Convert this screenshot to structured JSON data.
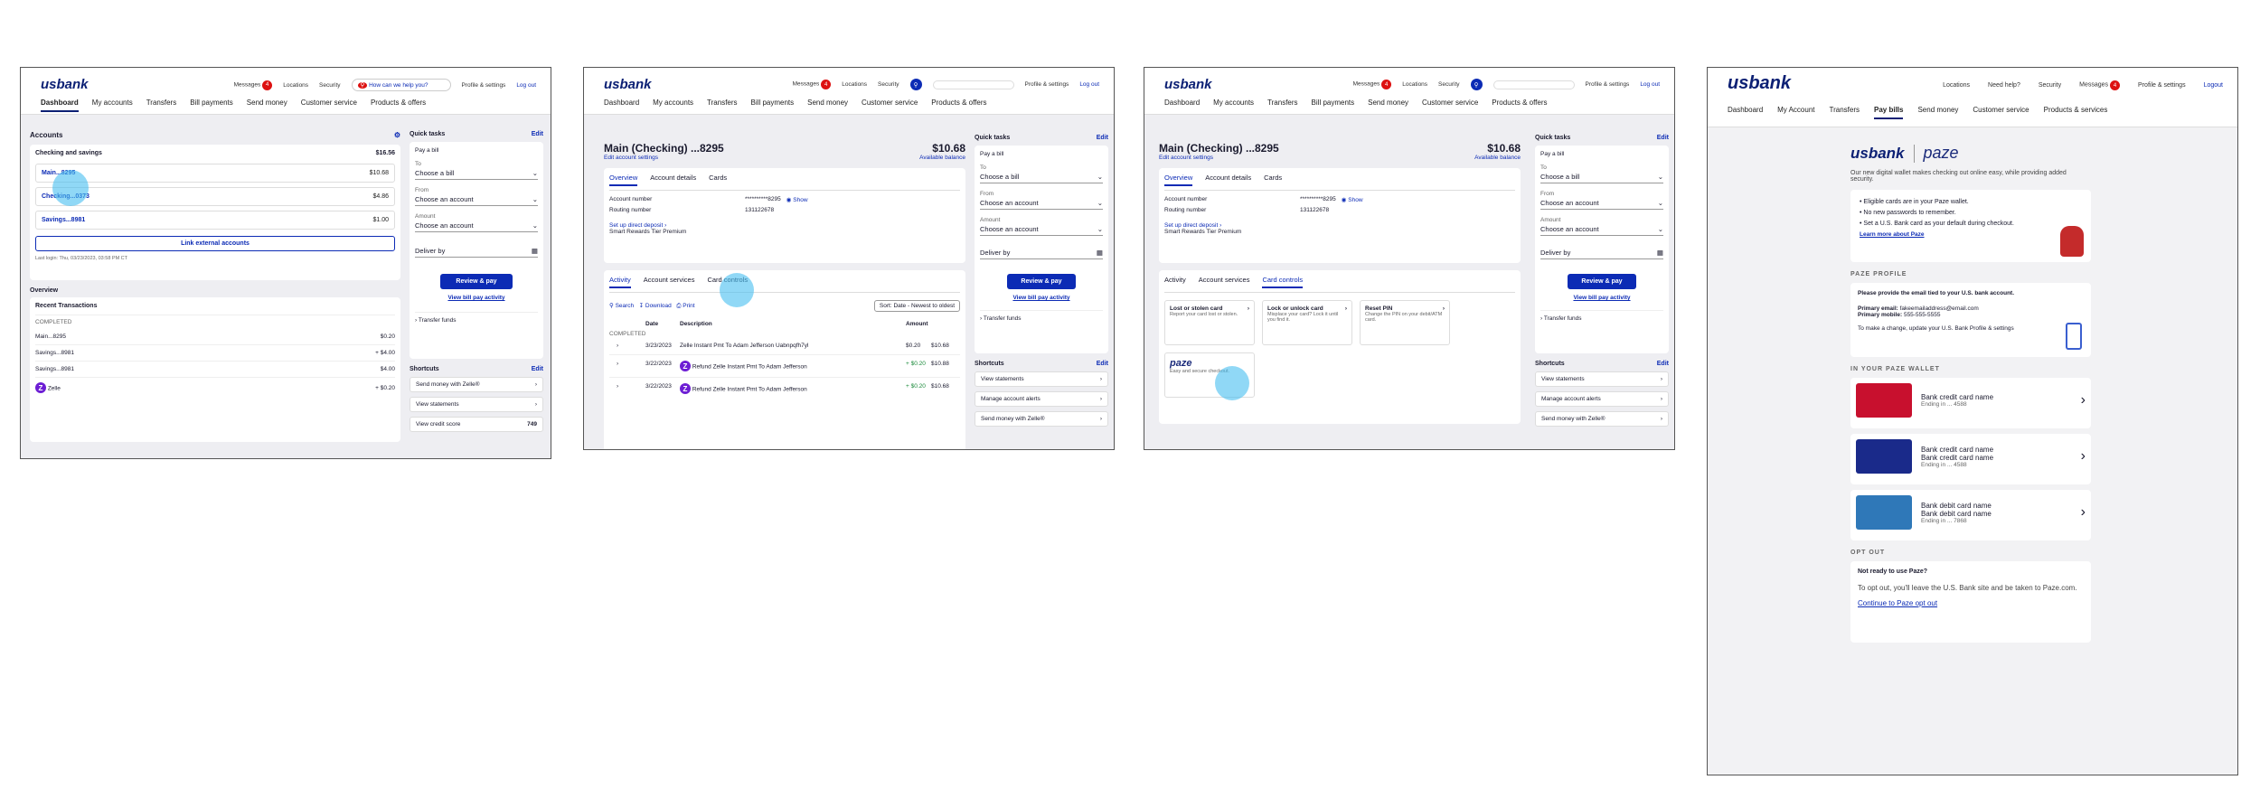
{
  "brand": {
    "logo": "usbank",
    "paze": "paze"
  },
  "header": {
    "messages": "Messages",
    "msg_count": "4",
    "locations": "Locations",
    "security": "Security",
    "help": "How can we help you?",
    "profile": "Profile & settings",
    "logout": "Log out"
  },
  "nav": [
    "Dashboard",
    "My accounts",
    "Transfers",
    "Bill payments",
    "Send money",
    "Customer service",
    "Products & offers"
  ],
  "s1": {
    "accounts": "Accounts",
    "cs": "Checking and savings",
    "cs_amt": "$16.56",
    "acc": [
      {
        "name": "Main...8295",
        "amt": "$10.68"
      },
      {
        "name": "Checking...0373",
        "amt": "$4.86"
      },
      {
        "name": "Savings...8981",
        "amt": "$1.00"
      }
    ],
    "link_ext": "Link external accounts",
    "last_login": "Last login: Thu, 03/23/2023, 03:58 PM CT",
    "overview": "Overview",
    "recent": "Recent Transactions",
    "completed": "COMPLETED",
    "tx": [
      {
        "n": "Main...8295",
        "a": "$0.20",
        "d": "3/23/2023"
      },
      {
        "n": "Savings...8981",
        "a": "+ $4.00",
        "d": "3/23/2023"
      },
      {
        "n": "Savings...8981",
        "a": "$4.00",
        "d": "3/20/2023"
      },
      {
        "n": "Zelle",
        "a": "+ $0.20",
        "d": "3/23/2023"
      }
    ]
  },
  "qt": {
    "title": "Quick tasks",
    "edit": "Edit",
    "pay": "Pay a bill",
    "to": "To",
    "choose_bill": "Choose a bill",
    "from": "From",
    "choose_acc": "Choose an account",
    "amount": "Amount",
    "deliver": "Deliver by",
    "review": "Review & pay",
    "view_bill": "View bill pay activity",
    "transfer": "Transfer funds",
    "shortcuts": "Shortcuts",
    "sc1": [
      "Send money with Zelle®",
      "View statements",
      "View credit score"
    ],
    "score": "749",
    "sc2": [
      "View statements",
      "Manage account alerts",
      "Send money with Zelle®"
    ]
  },
  "s2": {
    "title": "Main (Checking) ...8295",
    "edit_name": "Edit account settings",
    "bal": "$10.68",
    "avail": "Available balance",
    "tabs": [
      "Overview",
      "Account details",
      "Cards"
    ],
    "acct_no": "Account number",
    "acct_val": "**********8295",
    "show": "Show",
    "routing": "Routing number",
    "routing_val": "131122678",
    "direct": "Set up direct deposit",
    "tier": "Smart Rewards Tier Premium",
    "tabs2": [
      "Activity",
      "Account services",
      "Card controls"
    ],
    "search": "Search",
    "download": "Download",
    "print": "Print",
    "sort": "Sort: Date - Newest to oldest",
    "cols": [
      "Date",
      "Description",
      "Amount"
    ],
    "completed": "COMPLETED",
    "tx": [
      {
        "d": "3/23/2023",
        "desc": "Zelle Instant Pmt To Adam Jefferson Uabnpqfh7yl",
        "a": "$0.20",
        "b": "$10.68"
      },
      {
        "d": "3/22/2023",
        "desc": "Refund Zelle Instant Pmt To Adam Jefferson",
        "a": "+ $0.20",
        "b": "$10.88"
      },
      {
        "d": "3/22/2023",
        "desc": "Refund Zelle Instant Pmt To Adam Jefferson",
        "a": "+ $0.20",
        "b": "$10.68"
      }
    ]
  },
  "s3": {
    "cards": [
      {
        "t": "Lost or stolen card",
        "d": "Report your card lost or stolen."
      },
      {
        "t": "Lock or unlock card",
        "d": "Misplace your card? Lock it until you find it."
      },
      {
        "t": "Reset PIN",
        "d": "Change the PIN on your debit/ATM card."
      }
    ],
    "paze_desc": "Easy and secure checkout."
  },
  "s4": {
    "nav": [
      "Dashboard",
      "My Account",
      "Transfers",
      "Pay bills",
      "Send money",
      "Customer service",
      "Products & services"
    ],
    "util": [
      "Locations",
      "Need help?",
      "Security",
      "Messages",
      "Profile & settings",
      "Logout"
    ],
    "intro": "Our new digital wallet makes checking out online easy, while providing added security.",
    "bullets": [
      "Eligible cards are in your Paze wallet.",
      "No new passwords to remember.",
      "Set a U.S. Bank card as your default during checkout."
    ],
    "learn": "Learn more about Paze",
    "profile_h": "PAZE PROFILE",
    "profile_q": "Please provide the email tied to your U.S. bank account.",
    "email_l": "Primary email:",
    "email_v": "fakeemailaddress@email.com",
    "mobile_l": "Primary mobile:",
    "mobile_v": "555-555-5555",
    "change": "To make a change, update your U.S. Bank Profile & settings",
    "wallet_h": "IN YOUR PAZE WALLET",
    "wcards": [
      {
        "n": "Bank credit card name",
        "e": "Ending in ... 4588"
      },
      {
        "n": "Bank credit card name",
        "n2": "Bank credit card name",
        "e": "Ending in ... 4588"
      },
      {
        "n": "Bank debit card name",
        "n2": "Bank debit card name",
        "e": "Ending in ... 7868"
      }
    ],
    "opt_h": "OPT OUT",
    "opt_q": "Not ready to use Paze?",
    "opt_t": "To opt out, you'll leave the U.S. Bank site and be taken to Paze.com.",
    "opt_l": "Continue to Paze opt out"
  }
}
